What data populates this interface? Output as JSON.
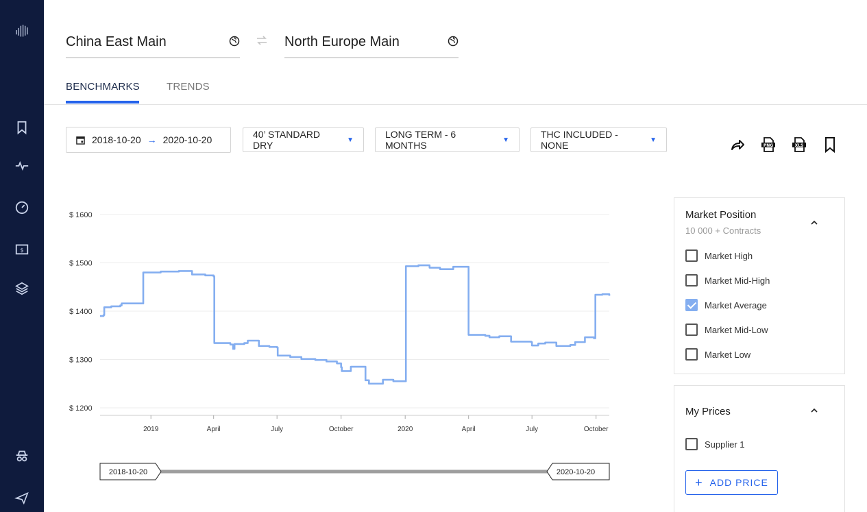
{
  "sidebar": {
    "icons": [
      "logo-icon",
      "bookmark-icon",
      "activity-icon",
      "speedometer-icon",
      "wallet-icon",
      "layers-icon",
      "incognito-icon",
      "airplane-icon"
    ]
  },
  "route": {
    "origin": "China East Main",
    "destination": "North Europe Main"
  },
  "tabs": [
    {
      "label": "BENCHMARKS",
      "active": true
    },
    {
      "label": "TRENDS",
      "active": false
    }
  ],
  "filters": {
    "date_from": "2018-10-20",
    "date_to": "2020-10-20",
    "container": "40’ STANDARD DRY",
    "term": "LONG TERM - 6 MONTHS",
    "thc": "THC INCLUDED - NONE"
  },
  "tools": [
    "share-icon",
    "png-export-icon",
    "xls-export-icon",
    "bookmark-icon"
  ],
  "range_slider": {
    "start": "2018-10-20",
    "end": "2020-10-20"
  },
  "market_position": {
    "title": "Market Position",
    "subtitle": "10 000 + Contracts",
    "options": [
      {
        "label": "Market High",
        "checked": false
      },
      {
        "label": "Market Mid-High",
        "checked": false
      },
      {
        "label": "Market Average",
        "checked": true
      },
      {
        "label": "Market Mid-Low",
        "checked": false
      },
      {
        "label": "Market Low",
        "checked": false
      }
    ]
  },
  "my_prices": {
    "title": "My Prices",
    "options": [
      {
        "label": "Supplier 1",
        "checked": false
      }
    ],
    "add_label": "ADD PRICE"
  },
  "colors": {
    "accent": "#2563eb",
    "sidebar": "#0f1b3d",
    "series": "#84aef0"
  },
  "chart_data": {
    "type": "line",
    "title": "",
    "xlabel": "",
    "ylabel": "",
    "ylim": [
      1200,
      1600
    ],
    "yticks": [
      "$ 1600",
      "$ 1500",
      "$ 1400",
      "$ 1300",
      "$ 1200"
    ],
    "xticks": [
      {
        "label": "2019",
        "date": "2019-01-01"
      },
      {
        "label": "April",
        "date": "2019-04-01"
      },
      {
        "label": "July",
        "date": "2019-07-01"
      },
      {
        "label": "October",
        "date": "2019-10-01"
      },
      {
        "label": "2020",
        "date": "2020-01-01"
      },
      {
        "label": "April",
        "date": "2020-04-01"
      },
      {
        "label": "July",
        "date": "2020-07-01"
      },
      {
        "label": "October",
        "date": "2020-10-01"
      }
    ],
    "x_range": [
      "2018-10-20",
      "2020-10-20"
    ],
    "step": true,
    "series": [
      {
        "values": [
          {
            "x": "2018-10-20",
            "y": 1390
          },
          {
            "x": "2018-10-25",
            "y": 1392
          },
          {
            "x": "2018-10-26",
            "y": 1408
          },
          {
            "x": "2018-11-05",
            "y": 1410
          },
          {
            "x": "2018-11-18",
            "y": 1412
          },
          {
            "x": "2018-11-20",
            "y": 1416
          },
          {
            "x": "2018-12-20",
            "y": 1416
          },
          {
            "x": "2018-12-21",
            "y": 1480
          },
          {
            "x": "2019-01-15",
            "y": 1482
          },
          {
            "x": "2019-02-10",
            "y": 1483
          },
          {
            "x": "2019-03-01",
            "y": 1476
          },
          {
            "x": "2019-03-20",
            "y": 1474
          },
          {
            "x": "2019-04-01",
            "y": 1472
          },
          {
            "x": "2019-04-02",
            "y": 1334
          },
          {
            "x": "2019-04-25",
            "y": 1331
          },
          {
            "x": "2019-04-29",
            "y": 1322
          },
          {
            "x": "2019-05-01",
            "y": 1332
          },
          {
            "x": "2019-05-15",
            "y": 1334
          },
          {
            "x": "2019-05-20",
            "y": 1339
          },
          {
            "x": "2019-06-05",
            "y": 1328
          },
          {
            "x": "2019-06-20",
            "y": 1326
          },
          {
            "x": "2019-07-01",
            "y": 1325
          },
          {
            "x": "2019-07-02",
            "y": 1308
          },
          {
            "x": "2019-07-20",
            "y": 1305
          },
          {
            "x": "2019-08-05",
            "y": 1301
          },
          {
            "x": "2019-08-25",
            "y": 1299
          },
          {
            "x": "2019-09-10",
            "y": 1296
          },
          {
            "x": "2019-09-25",
            "y": 1292
          },
          {
            "x": "2019-10-01",
            "y": 1284
          },
          {
            "x": "2019-10-02",
            "y": 1276
          },
          {
            "x": "2019-10-15",
            "y": 1285
          },
          {
            "x": "2019-11-05",
            "y": 1257
          },
          {
            "x": "2019-11-10",
            "y": 1250
          },
          {
            "x": "2019-11-30",
            "y": 1258
          },
          {
            "x": "2019-12-15",
            "y": 1255
          },
          {
            "x": "2020-01-01",
            "y": 1255
          },
          {
            "x": "2020-01-02",
            "y": 1493
          },
          {
            "x": "2020-01-20",
            "y": 1495
          },
          {
            "x": "2020-02-05",
            "y": 1490
          },
          {
            "x": "2020-02-20",
            "y": 1487
          },
          {
            "x": "2020-03-10",
            "y": 1492
          },
          {
            "x": "2020-03-31",
            "y": 1492
          },
          {
            "x": "2020-04-01",
            "y": 1351
          },
          {
            "x": "2020-04-25",
            "y": 1349
          },
          {
            "x": "2020-05-01",
            "y": 1346
          },
          {
            "x": "2020-05-15",
            "y": 1348
          },
          {
            "x": "2020-06-01",
            "y": 1337
          },
          {
            "x": "2020-06-30",
            "y": 1336
          },
          {
            "x": "2020-07-01",
            "y": 1329
          },
          {
            "x": "2020-07-10",
            "y": 1333
          },
          {
            "x": "2020-07-20",
            "y": 1335
          },
          {
            "x": "2020-08-05",
            "y": 1328
          },
          {
            "x": "2020-08-25",
            "y": 1330
          },
          {
            "x": "2020-09-01",
            "y": 1336
          },
          {
            "x": "2020-09-15",
            "y": 1346
          },
          {
            "x": "2020-09-28",
            "y": 1344
          },
          {
            "x": "2020-09-30",
            "y": 1434
          },
          {
            "x": "2020-10-10",
            "y": 1435
          },
          {
            "x": "2020-10-20",
            "y": 1432
          }
        ]
      }
    ]
  }
}
